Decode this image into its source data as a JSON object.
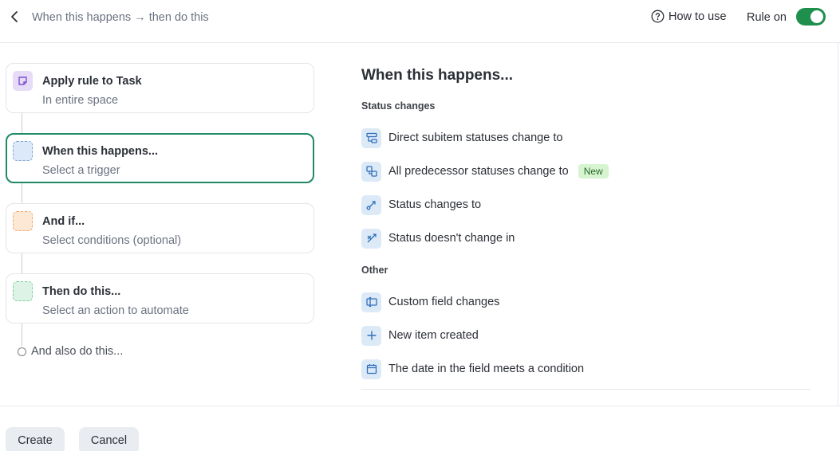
{
  "header": {
    "title": "When this happens → then do this",
    "how_to_use": "How to use",
    "rule_label": "Rule on",
    "rule_enabled": true
  },
  "steps": [
    {
      "title": "Apply rule to Task",
      "subtitle": "In entire space",
      "color": "#e7dcf8"
    },
    {
      "title": "When this happens...",
      "subtitle": "Select a trigger",
      "color": "#dce9f8",
      "active": true
    },
    {
      "title": "And if...",
      "subtitle": "Select conditions (optional)",
      "color": "#fde8d6"
    },
    {
      "title": "Then do this...",
      "subtitle": "Select an action to automate",
      "color": "#dcf3e6"
    }
  ],
  "also_label": "And also do this...",
  "panel": {
    "title": "When this happens...",
    "sections": [
      {
        "label": "Status changes",
        "options": [
          {
            "label": "Direct subitem statuses change to",
            "icon": "subitems-icon"
          },
          {
            "label": "All predecessor statuses change to",
            "icon": "dependency-icon",
            "badge": "New"
          },
          {
            "label": "Status changes to",
            "icon": "status-change-icon"
          },
          {
            "label": "Status doesn't change in",
            "icon": "status-no-change-icon"
          }
        ]
      },
      {
        "label": "Other",
        "options": [
          {
            "label": "Custom field changes",
            "icon": "custom-field-icon"
          },
          {
            "label": "New item created",
            "icon": "plus-icon"
          },
          {
            "label": "The date in the field meets a condition",
            "icon": "calendar-icon"
          }
        ]
      }
    ]
  },
  "footer": {
    "create_label": "Create",
    "cancel_label": "Cancel"
  },
  "colors": {
    "accent_green": "#1f8f4d",
    "active_border": "#1f8a64",
    "new_badge_bg": "#d6f4cf"
  }
}
